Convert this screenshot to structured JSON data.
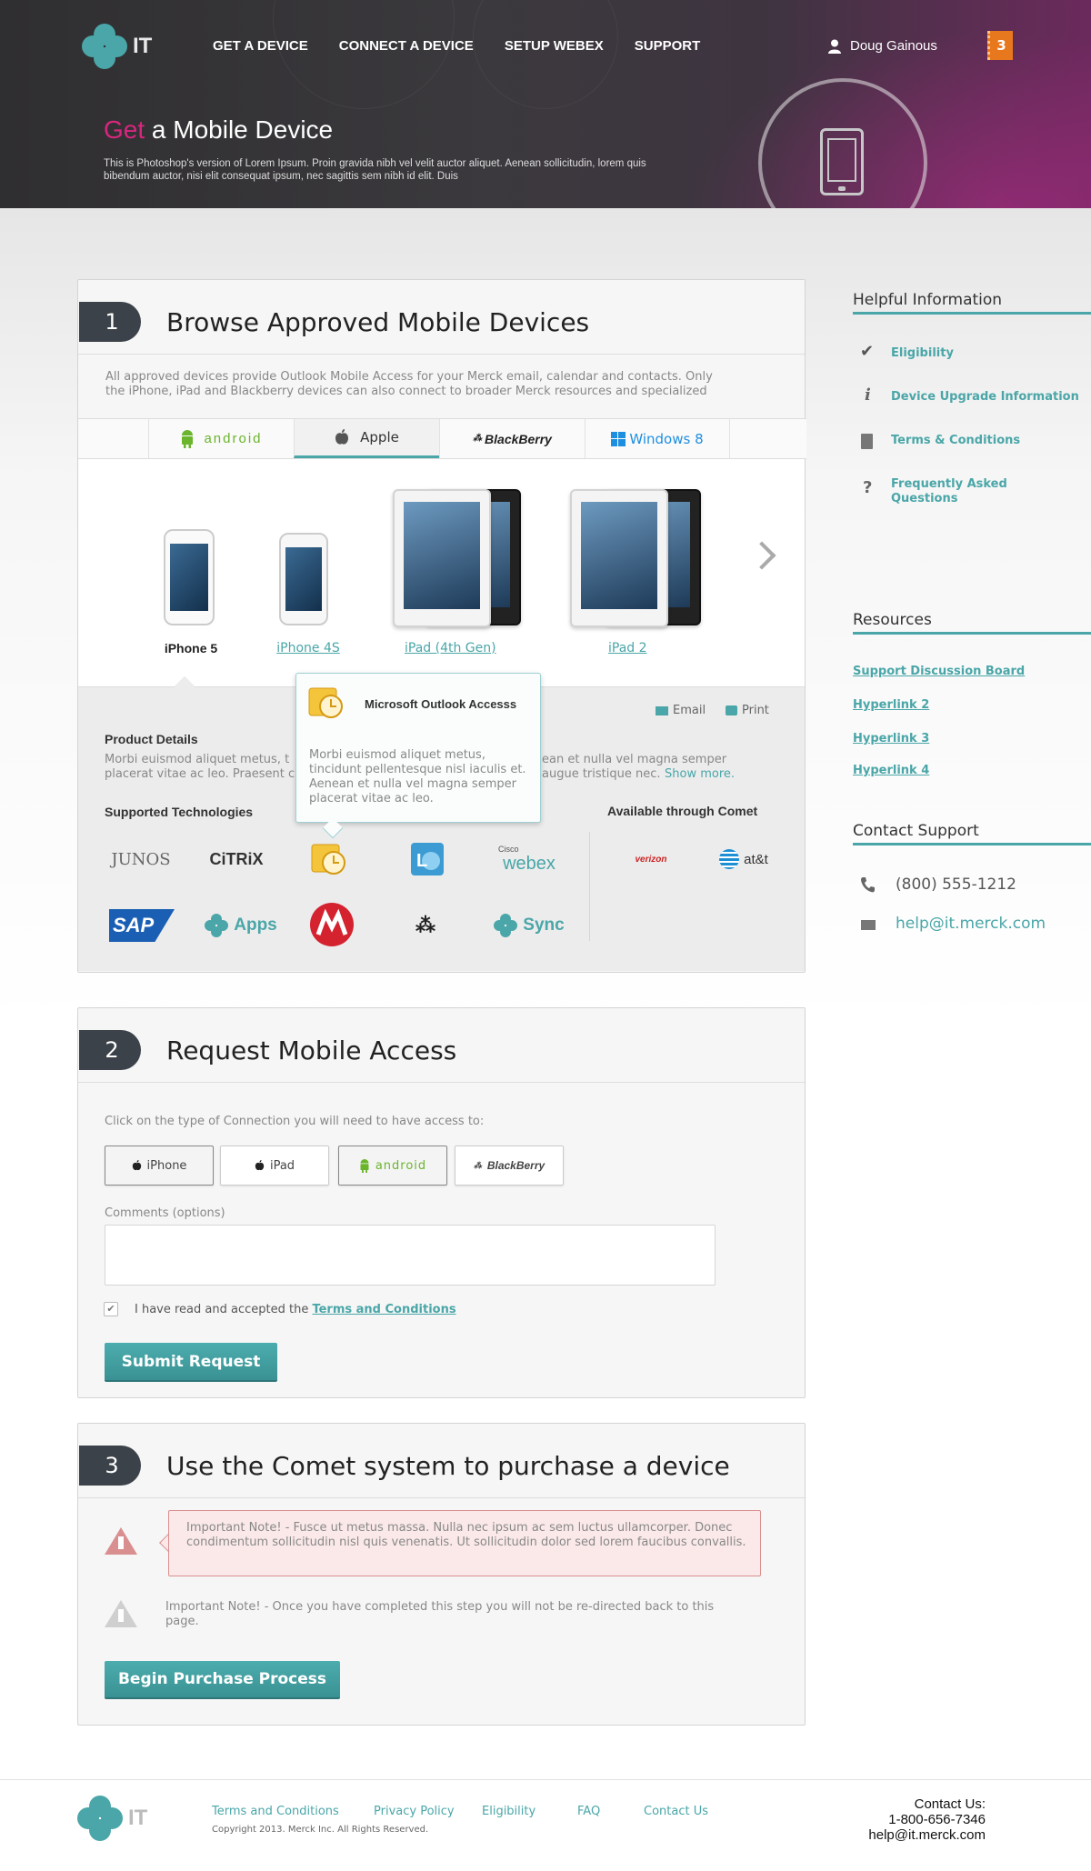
{
  "header": {
    "logo_text": "IT",
    "nav": [
      "GET A DEVICE",
      "CONNECT A DEVICE",
      "SETUP WEBEX",
      "SUPPORT"
    ],
    "user": "Doug Gainous",
    "notifications": "3",
    "title_highlight": "Get",
    "title_rest": " a Mobile Device",
    "description": "This is Photoshop's version of Lorem Ipsum. Proin gravida nibh vel velit auctor aliquet. Aenean sollicitudin, lorem quis bibendum auctor, nisi elit consequat ipsum, nec sagittis sem nibh id elit. Duis"
  },
  "step1": {
    "number": "1",
    "title": "Browse Approved Mobile Devices",
    "intro": "All approved devices provide Outlook Mobile Access for your Merck email, calendar and contacts. Only the iPhone, iPad and Blackberry devices can also connect to broader Merck resources and specialized",
    "tabs": [
      "android",
      "Apple",
      "BlackBerry",
      "Windows 8"
    ],
    "devices": [
      "iPhone 5",
      "iPhone 4S",
      "iPad (4th Gen)",
      "iPad 2"
    ],
    "email": "Email",
    "print": "Print",
    "product_details": "Product Details",
    "product_text_left": "Morbi euismod aliquet metus, t",
    "product_text_left2": "placerat vitae ac leo. Praesent c",
    "product_text_right": "ean et nulla vel magna semper",
    "product_text_right2": "augue tristique nec.",
    "show_more": "Show more.",
    "supported": "Supported Technologies",
    "available": "Available through Comet",
    "tech": [
      "JUNOS",
      "CiTRiX",
      "webex",
      "SAP",
      "Apps",
      "Sync"
    ],
    "tech_small": "Cisco",
    "carriers": [
      "verizon",
      "at&t"
    ],
    "tooltip_title": "Microsoft Outlook Accesss",
    "tooltip_body": "Morbi euismod aliquet metus, tincidunt pellentesque nisl iaculis et. Aenean et nulla vel magna semper placerat vitae ac leo."
  },
  "sidebar": {
    "helpful": "Helpful Information",
    "links": [
      "Eligibility",
      "Device Upgrade Information",
      "Terms & Conditions",
      "Frequently Asked Questions"
    ],
    "resources": "Resources",
    "resource_links": [
      "Support Discussion Board",
      "Hyperlink 2",
      "Hyperlink 3",
      "Hyperlink 4"
    ],
    "contact": "Contact Support",
    "phone": "(800) 555-1212",
    "email": "help@it.merck.com"
  },
  "step2": {
    "number": "2",
    "title": "Request Mobile Access",
    "prompt": "Click on the type of Connection you will need to have access to:",
    "types": [
      "iPhone",
      "iPad",
      "android",
      "BlackBerry"
    ],
    "comments_label": "Comments (options)",
    "comments_value": "",
    "terms_text": "I have read and accepted the ",
    "terms_link": "Terms and Conditions",
    "submit": "Submit Request"
  },
  "step3": {
    "number": "3",
    "title": "Use the Comet system to purchase a device",
    "note1": "Important Note! - Fusce ut metus massa. Nulla nec ipsum ac sem luctus ullamcorper. Donec condimentum sollicitudin nisl quis venenatis. Ut sollicitudin dolor sed lorem faucibus convallis.",
    "note2": "Important Note! - Once you have completed this step you will not be re-directed back to this page.",
    "button": "Begin Purchase Process"
  },
  "footer": {
    "logo_text": "IT",
    "links": [
      "Terms and Conditions",
      "Privacy Policy",
      "Eligibility",
      "FAQ",
      "Contact Us"
    ],
    "copyright": "Copyright 2013.  Merck Inc.  All Rights Reserved.",
    "contact_title": "Contact Us:",
    "contact_phone": "1-800-656-7346",
    "contact_email": "help@it.merck.com"
  },
  "colors": {
    "teal": "#4aa6a8",
    "magenta": "#d8267f",
    "orange": "#e8781e",
    "dark": "#3c4249"
  }
}
